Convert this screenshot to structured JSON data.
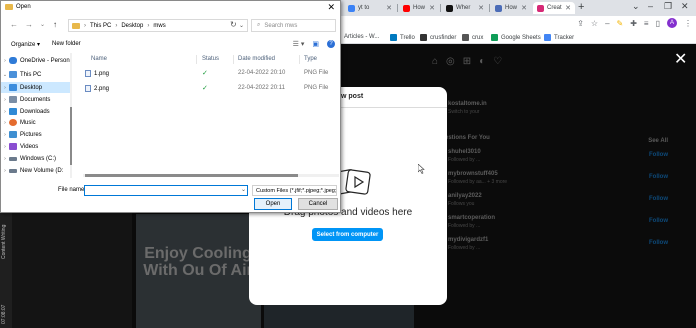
{
  "browser": {
    "tabs": [
      {
        "label": "yt to",
        "favicon_color": "#3b82f6"
      },
      {
        "label": "How",
        "favicon_color": "#ff0000"
      },
      {
        "label": "Wher",
        "favicon_color": "#111111"
      },
      {
        "label": "How",
        "favicon_color": "#4b6cb7"
      },
      {
        "label": "Creat",
        "favicon_color": "#d62976"
      }
    ],
    "bookmarks": [
      {
        "label": "Articles - W...",
        "color": "#1a73e8"
      },
      {
        "label": "Trello",
        "color": "#0079bf"
      },
      {
        "label": "crusfinder",
        "color": "#333333"
      },
      {
        "label": "crux",
        "color": "#555555"
      },
      {
        "label": "Google Sheets",
        "color": "#0f9d58"
      },
      {
        "label": "Tracker",
        "color": "#4285f4"
      }
    ],
    "profile_initial": "A"
  },
  "side_rail": {
    "text_top": "Content Writing",
    "text_bottom": "07:08:07"
  },
  "instagram": {
    "modal": {
      "title": "new post",
      "drag_text": "Drag photos and videos here",
      "select_button": "Select from computer"
    },
    "post_text": "Enjoy Cooling With Ou Of Air",
    "post_text2": "iriltetvlc",
    "suggestions": [
      {
        "name": "kostaltome.in",
        "sub": "Switch to your",
        "follow": ""
      },
      {
        "name": "Suggestions For You",
        "sub": "",
        "follow": "See All"
      },
      {
        "name": "shuhel3010",
        "sub": "Followed by ...",
        "follow": "Follow"
      },
      {
        "name": "mybrownstuff405",
        "sub": "Followed by aa... + 3 more",
        "follow": "Follow"
      },
      {
        "name": "anilyay2022",
        "sub": "Follows you",
        "follow": "Follow"
      },
      {
        "name": "smartcoperation",
        "sub": "Followed by ...",
        "follow": "Follow"
      },
      {
        "name": "mydivigardzf1",
        "sub": "Followed by ...",
        "follow": "Follow"
      }
    ]
  },
  "dialog": {
    "title": "Open",
    "breadcrumb": [
      "This PC",
      "Desktop",
      "mws"
    ],
    "search_placeholder": "Search mws",
    "organize": "Organize",
    "new_folder": "New folder",
    "tree": [
      {
        "label": "OneDrive - Person",
        "color": "#2f7bd7",
        "chevron": "›",
        "selected": false
      },
      {
        "label": "This PC",
        "color": "#4a90d9",
        "chevron": "⌄",
        "selected": false
      },
      {
        "label": "Desktop",
        "color": "#3c8ddd",
        "chevron": "›",
        "selected": true
      },
      {
        "label": "Documents",
        "color": "#7a8ea6",
        "chevron": "›",
        "selected": false
      },
      {
        "label": "Downloads",
        "color": "#2f8ad6",
        "chevron": "›",
        "selected": false
      },
      {
        "label": "Music",
        "color": "#e46c2f",
        "chevron": "›",
        "selected": false
      },
      {
        "label": "Pictures",
        "color": "#3f8fd1",
        "chevron": "›",
        "selected": false
      },
      {
        "label": "Videos",
        "color": "#8a4ed1",
        "chevron": "›",
        "selected": false
      },
      {
        "label": "Windows (C:)",
        "color": "#6b7a8c",
        "chevron": "›",
        "selected": false
      },
      {
        "label": "New Volume (D:",
        "color": "#6b7a8c",
        "chevron": "›",
        "selected": false
      }
    ],
    "columns": [
      "Name",
      "Status",
      "Date modified",
      "Type"
    ],
    "files": [
      {
        "name": "1.png",
        "status": "✓",
        "date": "22-04-2022 20:10",
        "type": "PNG File"
      },
      {
        "name": "2.png",
        "status": "✓",
        "date": "22-04-2022 20:11",
        "type": "PNG File"
      }
    ],
    "file_name_label": "File name:",
    "file_name_value": "",
    "filter": "Custom Files (*.jfif;*.pjpeg;*.jpeg;",
    "open_button": "Open",
    "cancel_button": "Cancel"
  }
}
